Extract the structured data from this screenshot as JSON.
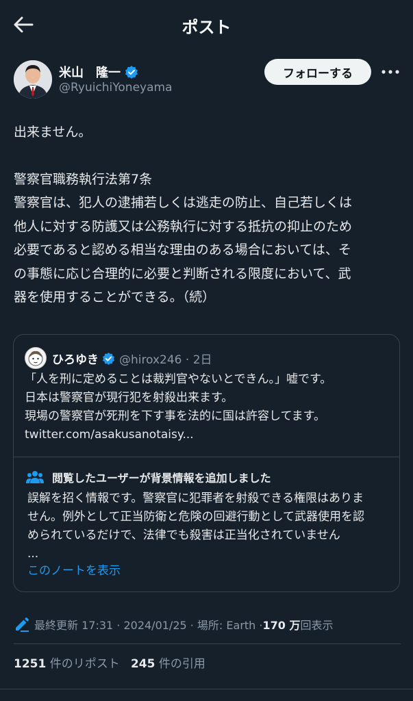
{
  "header": {
    "title": "ポスト"
  },
  "author": {
    "name": "米山　隆一",
    "handle": "@RyuichiYoneyama",
    "follow_label": "フォローする"
  },
  "post": {
    "line1": "出来ません。",
    "line2": "警察官職務執行法第7条",
    "line3": "警察官は、犯人の逮捕若しくは逃走の防止、自己若しくは",
    "line4": "他人に対する防護又は公務執行に対する抵抗の抑止のため",
    "line5": "必要であると認める相当な理由のある場合においては、そ",
    "line6": "の事態に応じ合理的に必要と判断される限度において、武",
    "line7": "器を使用することができる。（続）"
  },
  "quote": {
    "name": "ひろゆき",
    "handle_time": "@hirox246 · 2日",
    "line1": "「人を刑に定めることは裁判官やないとできん。」嘘です。",
    "line2": "日本は警察官が現行犯を射殺出来ます。",
    "line3": "現場の警察官が死刑を下す事を法的に国は許容してます。",
    "line4": "twitter.com/asakusanotaisy...",
    "note_title": "閲覧したユーザーが背景情報を追加しました",
    "note_line1": "誤解を招く情報です。警察官に犯罪者を射殺できる権限はありま",
    "note_line2": "せん。例外として正当防衛と危険の回避行動として武器使用を認",
    "note_line3": "められているだけで、法律でも殺害は正当化されていません",
    "note_line4": "...",
    "note_link": "このノートを表示"
  },
  "meta": {
    "updated": "最終更新 17:31 · 2024/01/25 · 場所: Earth · ",
    "views_count": "170 万",
    "views_label": "回表示"
  },
  "stats": {
    "reposts_count": "1251",
    "reposts_label": " 件のリポスト",
    "quotes_count": "245",
    "quotes_label": " 件の引用"
  },
  "colors": {
    "background": "#15202b",
    "accent": "#1d9bf0",
    "muted": "#8b98a5"
  },
  "icons": {
    "back": "arrow-left-icon",
    "verified": "verified-badge-icon",
    "more": "more-horizontal-icon",
    "note": "people-icon",
    "edit": "pencil-icon"
  }
}
